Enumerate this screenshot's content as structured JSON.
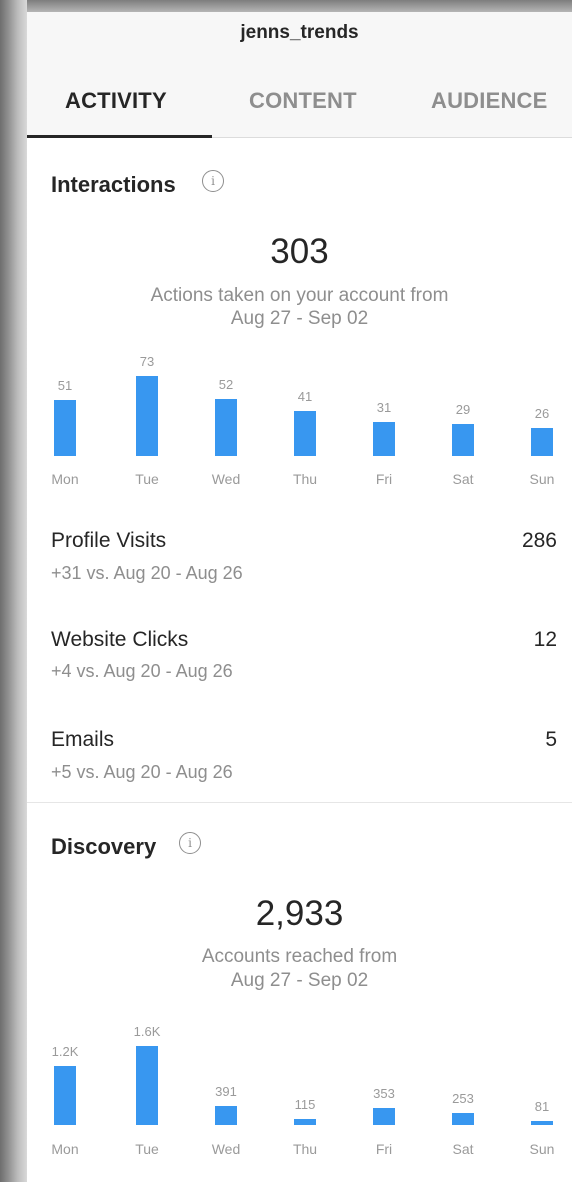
{
  "header": {
    "username": "jenns_trends",
    "tabs": [
      {
        "label": "ACTIVITY",
        "active": true
      },
      {
        "label": "CONTENT",
        "active": false
      },
      {
        "label": "AUDIENCE",
        "active": false
      }
    ]
  },
  "interactions": {
    "title": "Interactions",
    "info_icon": "info-icon",
    "total": "303",
    "caption_line1": "Actions taken on your account from",
    "caption_line2": "Aug 27 - Sep 02",
    "chart_data": {
      "type": "bar",
      "categories": [
        "Mon",
        "Tue",
        "Wed",
        "Thu",
        "Fri",
        "Sat",
        "Sun"
      ],
      "values": [
        51,
        73,
        52,
        41,
        31,
        29,
        26
      ],
      "labels": [
        "51",
        "73",
        "52",
        "41",
        "31",
        "29",
        "26"
      ],
      "ylim": [
        0,
        73
      ],
      "color": "#3897f0"
    },
    "metrics": [
      {
        "label": "Profile Visits",
        "value": "286",
        "sub": "+31 vs. Aug 20 - Aug 26"
      },
      {
        "label": "Website Clicks",
        "value": "12",
        "sub": "+4 vs. Aug 20 - Aug 26"
      },
      {
        "label": "Emails",
        "value": "5",
        "sub": "+5 vs. Aug 20 - Aug 26"
      }
    ]
  },
  "discovery": {
    "title": "Discovery",
    "info_icon": "info-icon",
    "total": "2,933",
    "caption_line1": "Accounts reached from",
    "caption_line2": "Aug 27 - Sep 02",
    "chart_data": {
      "type": "bar",
      "categories": [
        "Mon",
        "Tue",
        "Wed",
        "Thu",
        "Fri",
        "Sat",
        "Sun"
      ],
      "values": [
        1200,
        1600,
        391,
        115,
        353,
        253,
        81
      ],
      "labels": [
        "1.2K",
        "1.6K",
        "391",
        "115",
        "353",
        "253",
        "81"
      ],
      "ylim": [
        0,
        1600
      ],
      "color": "#3897f0"
    }
  },
  "colors": {
    "accent": "#3897f0",
    "text": "#262626",
    "muted": "#8e8e8e"
  }
}
